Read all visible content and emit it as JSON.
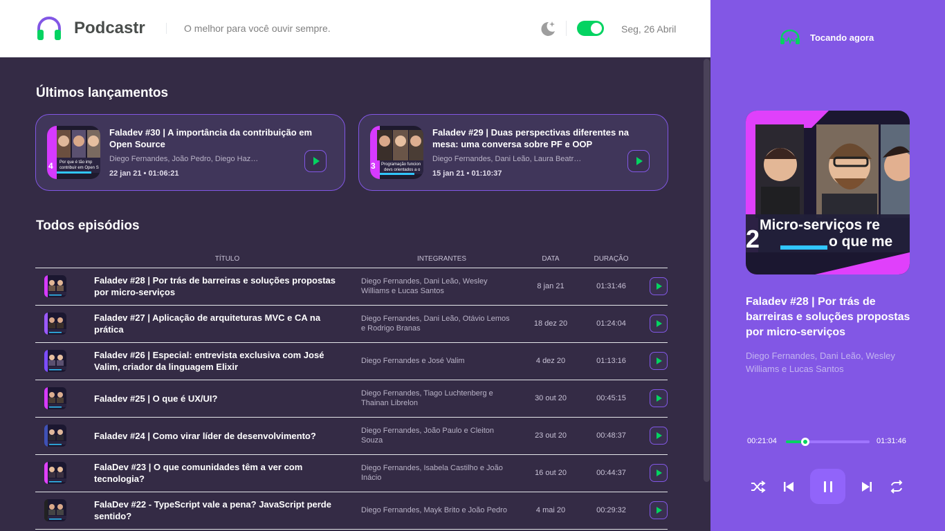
{
  "header": {
    "brand": "Podcastr",
    "tagline": "O melhor para você ouvir sempre.",
    "date": "Seg, 26 Abril",
    "theme_toggle_on": true,
    "icons": {
      "logo": "headphones-logo-icon",
      "theme": "moon-star-icon"
    }
  },
  "colors": {
    "accent": "#8257e5",
    "green": "#04d361",
    "bg_main": "#342b45",
    "card_bg": "#40365a"
  },
  "latest": {
    "title": "Últimos lançamentos",
    "episodes": [
      {
        "title": "Faladev #30 | A importância da contribuição em Open Source",
        "members": "Diego Fernandes, João Pedro, Diego Haz…",
        "published": "22 jan 21",
        "duration": "01:06:21",
        "meta": "22 jan 21 • 01:06:21",
        "thumb_text": "Por que é tão importante contribuir em Open Source"
      },
      {
        "title": "Faladev #29 | Duas perspectivas diferentes na mesa: uma conversa sobre PF e OOP",
        "members": "Diego Fernandes, Dani Leão, Laura Beatr…",
        "published": "15 jan 21",
        "duration": "01:10:37",
        "meta": "15 jan 21 • 01:10:37",
        "thumb_text": "Programação funcional devs orientados a objeto"
      }
    ]
  },
  "all": {
    "title": "Todos episódios",
    "columns": [
      "Título",
      "Integrantes",
      "Data",
      "Duração"
    ],
    "episodes": [
      {
        "title": "Faladev #28 | Por trás de barreiras e soluções propostas por micro-serviços",
        "members": "Diego Fernandes, Dani Leão, Wesley Williams e Lucas Santos",
        "date": "8 jan 21",
        "duration": "01:31:46"
      },
      {
        "title": "Faladev #27 | Aplicação de arquiteturas MVC e CA na prática",
        "members": "Diego Fernandes, Dani Leão, Otávio Lemos e Rodrigo Branas",
        "date": "18 dez 20",
        "duration": "01:24:04"
      },
      {
        "title": "Faladev #26 | Especial: entrevista exclusiva com José Valim, criador da linguagem Elixir",
        "members": "Diego Fernandes e José Valim",
        "date": "4 dez 20",
        "duration": "01:13:16"
      },
      {
        "title": "Faladev #25 | O que é UX/UI?",
        "members": "Diego Fernandes, Tiago Luchtenberg e Thainan Librelon",
        "date": "30 out 20",
        "duration": "00:45:15"
      },
      {
        "title": "Faladev #24 | Como virar líder de desenvolvimento?",
        "members": "Diego Fernandes, João Paulo e Cleiton Souza",
        "date": "23 out 20",
        "duration": "00:48:37"
      },
      {
        "title": "FalaDev #23 | O que comunidades têm a ver com tecnologia?",
        "members": "Diego Fernandes, Isabela Castilho e João Inácio",
        "date": "16 out 20",
        "duration": "00:44:37"
      },
      {
        "title": "FalaDev #22 - TypeScript vale a pena? JavaScript perde sentido?",
        "members": "Diego Fernandes, Mayk Brito e João Pedro",
        "date": "4 mai 20",
        "duration": "00:29:32"
      }
    ]
  },
  "player": {
    "now_playing": "Tocando agora",
    "cover_text_1": "Micro-serviços re",
    "cover_text_2": "o que me",
    "cover_number": "2",
    "title": "Faladev #28 | Por trás de barreiras e soluções propostas por micro-serviços",
    "members": "Diego Fernandes, Dani Leão, Wesley Williams e Lucas Santos",
    "current_time": "00:21:04",
    "total_time": "01:31:46",
    "progress": 0.23,
    "icons": [
      "shuffle-icon",
      "previous-icon",
      "pause-icon",
      "next-icon",
      "repeat-icon"
    ]
  }
}
